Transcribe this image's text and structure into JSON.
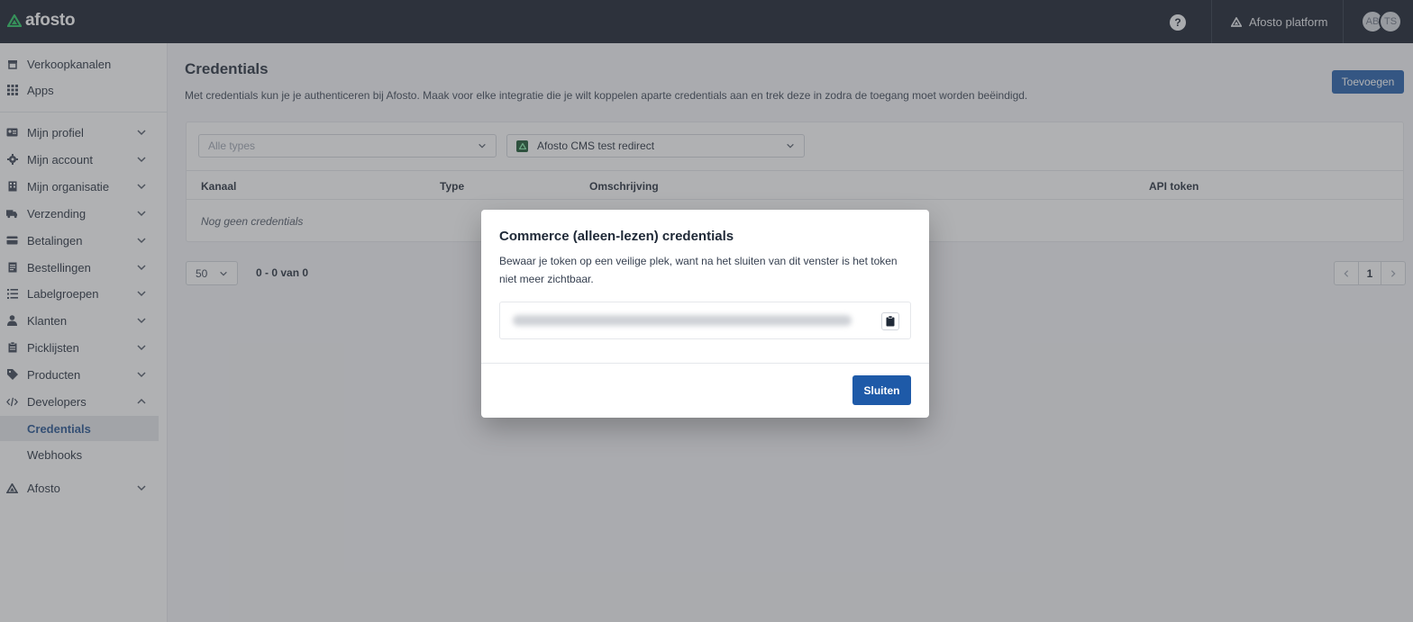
{
  "topbar": {
    "logo_text": "afosto",
    "help_symbol": "?",
    "platform_label": "Afosto platform",
    "avatars": [
      "AB",
      "TS"
    ]
  },
  "sidebar": {
    "items": [
      {
        "label": "Verkoopkanalen",
        "icon": "store-icon"
      },
      {
        "label": "Apps",
        "icon": "apps-grid-icon"
      },
      {
        "label": "Mijn profiel",
        "icon": "id-card-icon"
      },
      {
        "label": "Mijn account",
        "icon": "gear-icon"
      },
      {
        "label": "Mijn organisatie",
        "icon": "building-icon"
      },
      {
        "label": "Verzending",
        "icon": "truck-icon"
      },
      {
        "label": "Betalingen",
        "icon": "credit-card-icon"
      },
      {
        "label": "Bestellingen",
        "icon": "receipt-icon"
      },
      {
        "label": "Labelgroepen",
        "icon": "list-icon"
      },
      {
        "label": "Klanten",
        "icon": "user-icon"
      },
      {
        "label": "Picklijsten",
        "icon": "clipboard-icon"
      },
      {
        "label": "Producten",
        "icon": "tag-icon"
      },
      {
        "label": "Developers",
        "icon": "code-icon"
      },
      {
        "label": "Credentials"
      },
      {
        "label": "Webhooks"
      },
      {
        "label": "Afosto",
        "icon": "afosto-logo-icon"
      }
    ]
  },
  "main": {
    "title": "Credentials",
    "description": "Met credentials kun je je authenticeren bij Afosto. Maak voor elke integratie die je wilt koppelen aparte credentials aan en trek deze in zodra de toegang moet worden beëindigd.",
    "add_label": "Toevoegen",
    "filter_types_placeholder": "Alle types",
    "filter_channel_value": "Afosto CMS test redirect",
    "columns": [
      "Kanaal",
      "Type",
      "Omschrijving",
      "API token"
    ],
    "empty_text": "Nog geen credentials",
    "page_size": "50",
    "range_text": "0 - 0 van 0",
    "current_page": "1"
  },
  "modal": {
    "title": "Commerce (alleen-lezen) credentials",
    "text": "Bewaar je token op een veilige plek, want na het sluiten van dit venster is het token niet meer zichtbaar.",
    "close_label": "Sluiten"
  },
  "colors": {
    "topbar": "#111827",
    "primary": "#1e5aa8",
    "active_text": "#1e4e8c",
    "logo_green": "#22c55e"
  }
}
